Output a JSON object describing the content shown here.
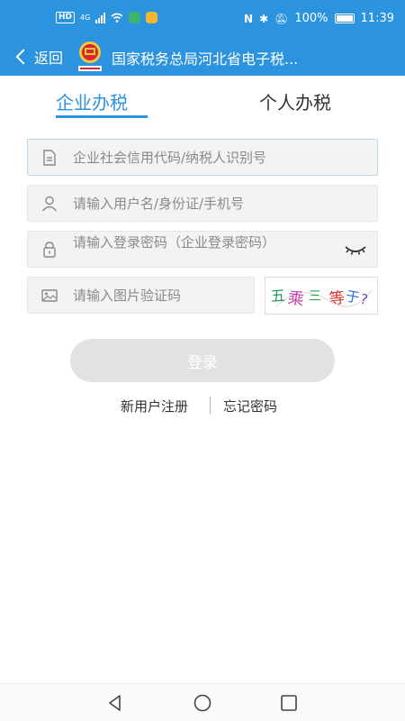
{
  "status_bar": {
    "network": "HD",
    "signal_gen": "4G",
    "battery": "100%",
    "time": "11:39"
  },
  "nav": {
    "back_label": "返回",
    "title": "国家税务总局河北省电子税...",
    "emblem_icon": "tax-emblem-icon"
  },
  "tabs": [
    {
      "label": "企业办税",
      "active": true
    },
    {
      "label": "个人办税",
      "active": false
    }
  ],
  "form": {
    "credit_code_placeholder": "企业社会信用代码/纳税人识别号",
    "username_placeholder": "请输入用户名/身份证/手机号",
    "password_placeholder": "请输入登录密码（企业登录密码）",
    "captcha_placeholder": "请输入图片验证码",
    "captcha_image_text": "五乘三等于?"
  },
  "login_button": "登录",
  "links": {
    "register": "新用户注册",
    "forgot": "忘记密码"
  },
  "colors": {
    "brand": "#2c93de",
    "button_disabled": "#e2e2e2"
  }
}
